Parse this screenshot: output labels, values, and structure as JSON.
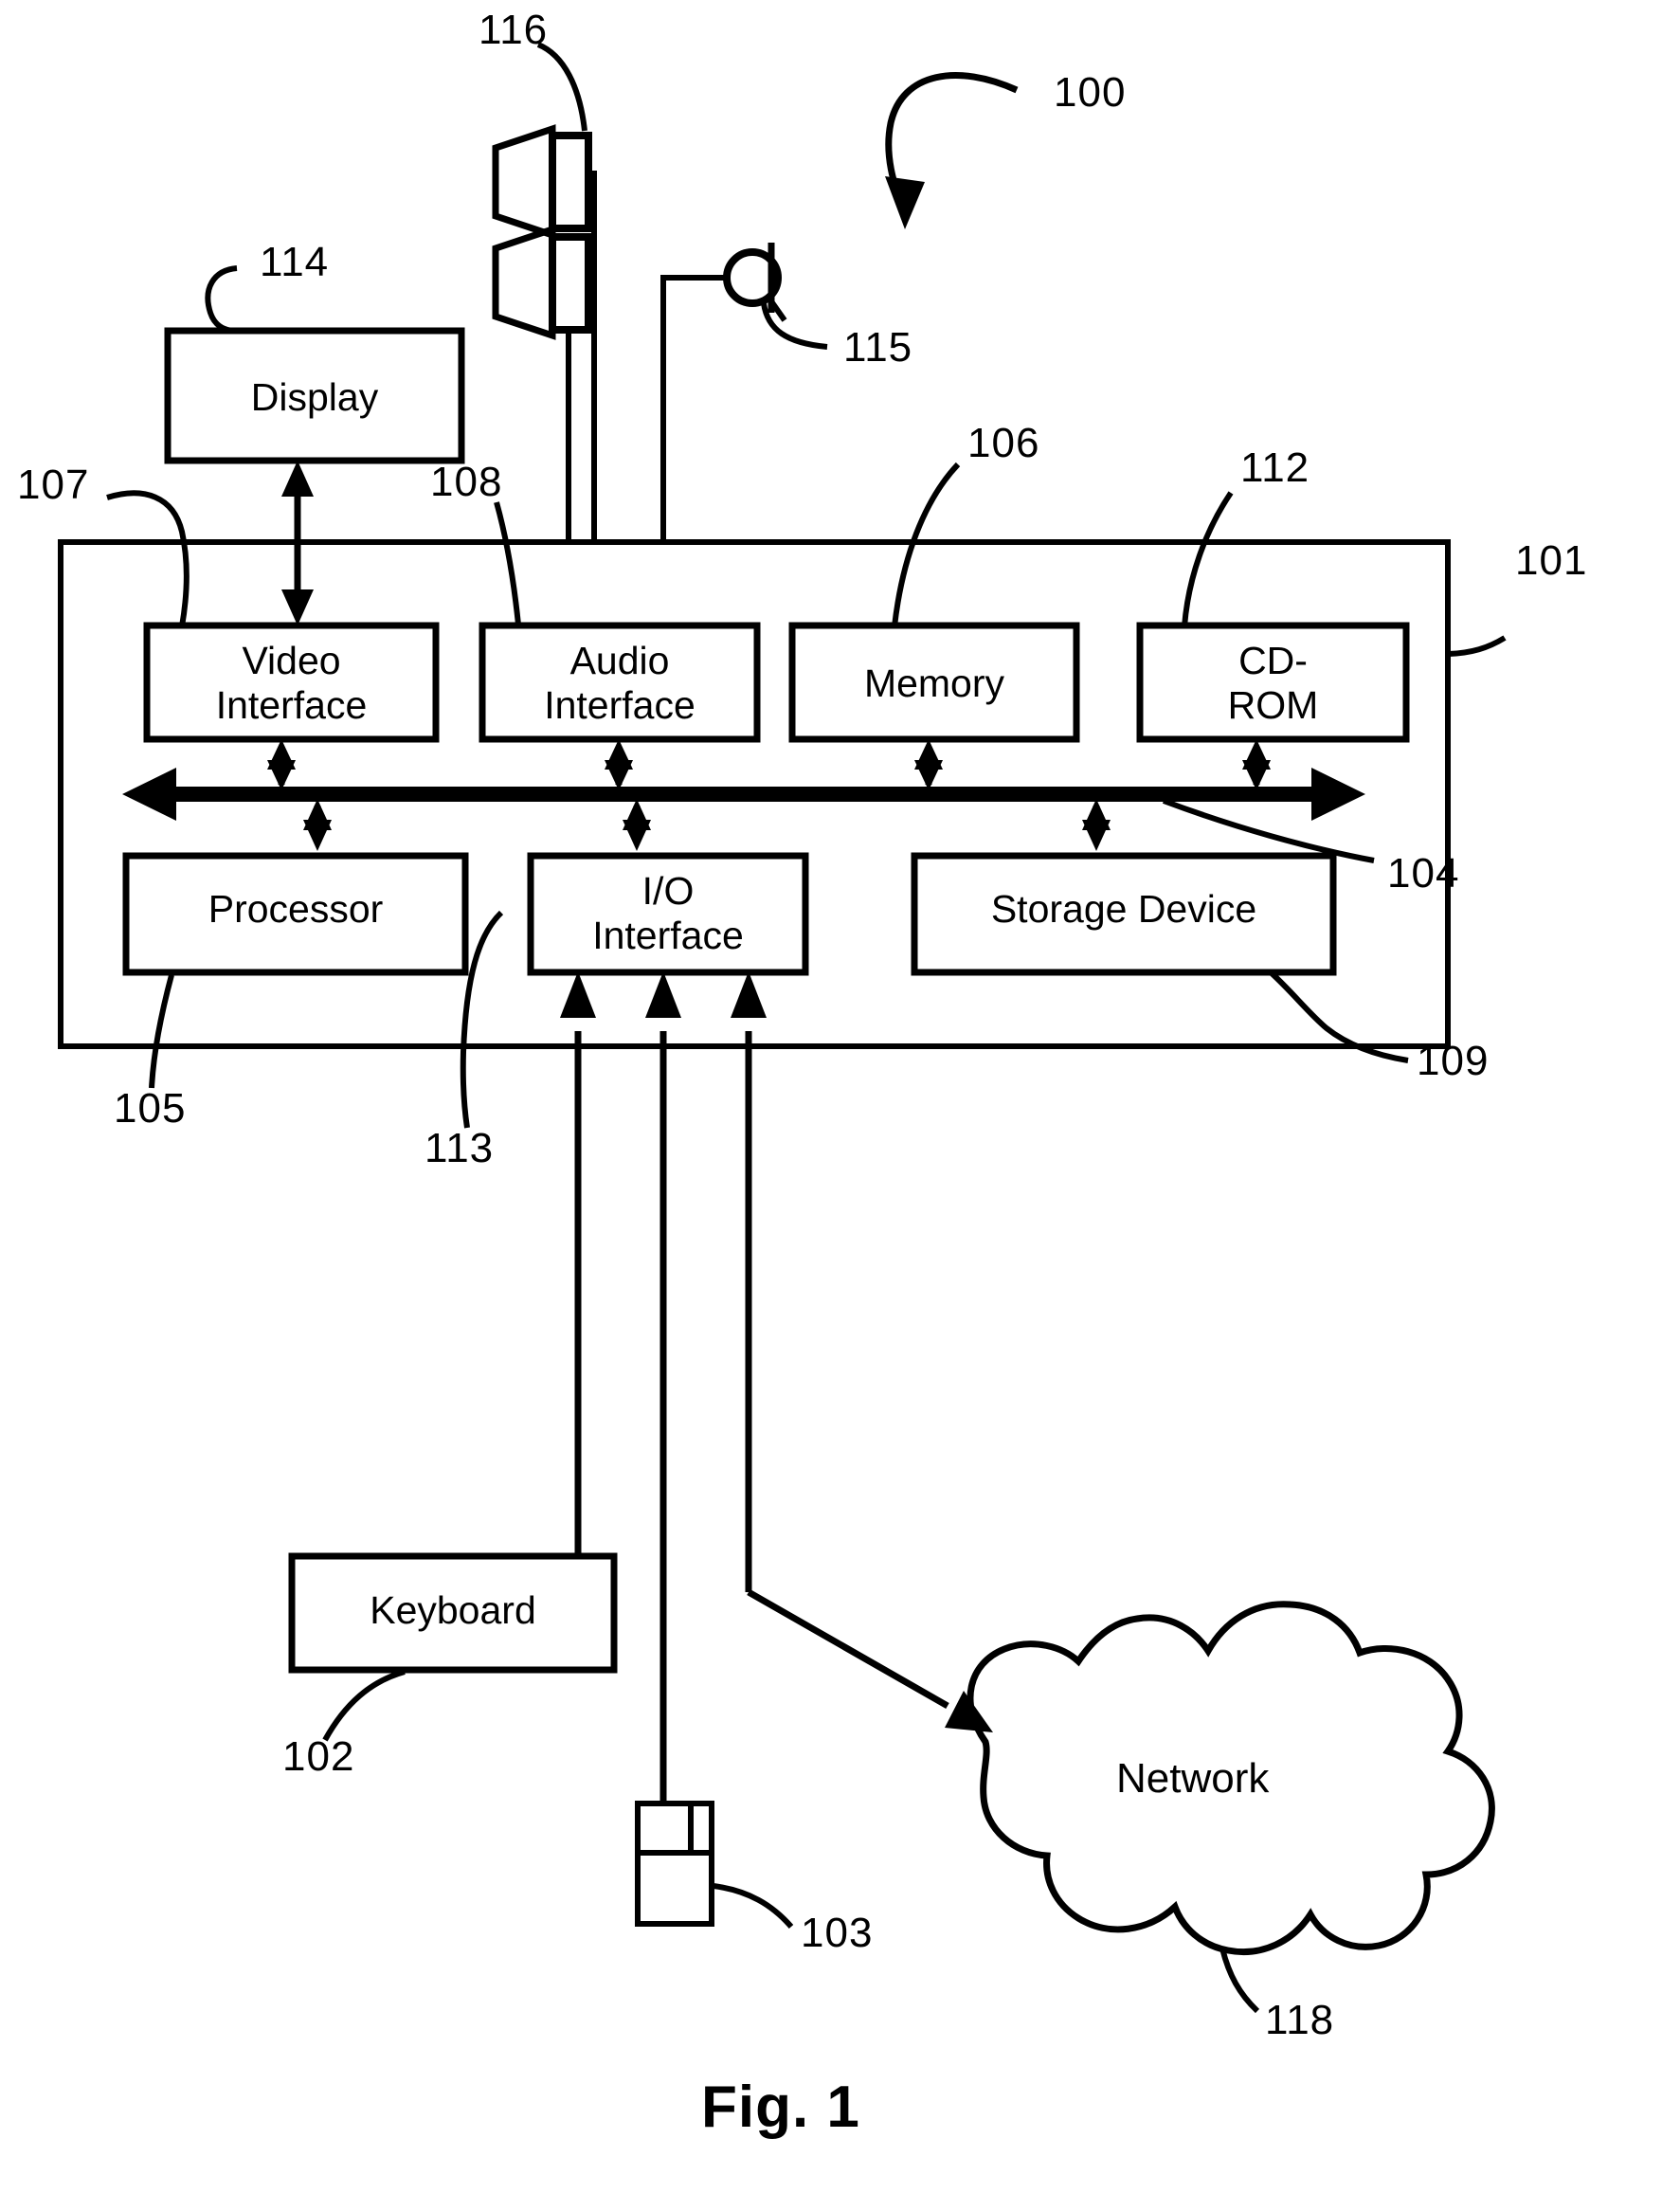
{
  "figure": {
    "caption": "Fig. 1",
    "system_ref": "100"
  },
  "components": [
    {
      "id": "display",
      "label": "Display",
      "ref": "114"
    },
    {
      "id": "video-interface",
      "label": "Video\nInterface",
      "ref": "107"
    },
    {
      "id": "audio-interface",
      "label": "Audio\nInterface",
      "ref": "108"
    },
    {
      "id": "memory",
      "label": "Memory",
      "ref": "106"
    },
    {
      "id": "cd-rom",
      "label": "CD-\nROM",
      "ref": "112"
    },
    {
      "id": "processor",
      "label": "Processor",
      "ref": "105"
    },
    {
      "id": "io-interface",
      "label": "I/O\nInterface",
      "ref": "113"
    },
    {
      "id": "storage-device",
      "label": "Storage Device",
      "ref": "109"
    },
    {
      "id": "keyboard",
      "label": "Keyboard",
      "ref": "102"
    },
    {
      "id": "network",
      "label": "Network",
      "ref": "118"
    }
  ],
  "peripherals": {
    "speakers": {
      "ref": "116"
    },
    "microphone": {
      "ref": "115"
    },
    "mouse": {
      "ref": "103"
    }
  },
  "enclosure": {
    "computer_ref": "101",
    "bus_ref": "104"
  },
  "ref_numbers": {
    "r100": "100",
    "r101": "101",
    "r102": "102",
    "r103": "103",
    "r104": "104",
    "r105": "105",
    "r106": "106",
    "r107": "107",
    "r108": "108",
    "r109": "109",
    "r112": "112",
    "r113": "113",
    "r114": "114",
    "r115": "115",
    "r116": "116",
    "r118": "118"
  },
  "labels": {
    "display": "Display",
    "video_interface": "Video\nInterface",
    "audio_interface": "Audio\nInterface",
    "memory": "Memory",
    "cd_rom": "CD-\nROM",
    "processor": "Processor",
    "io_interface": "I/O\nInterface",
    "storage_device": "Storage Device",
    "keyboard": "Keyboard",
    "network": "Network",
    "fig_caption": "Fig. 1"
  },
  "colors": {
    "stroke": "#000000",
    "background": "#ffffff"
  }
}
